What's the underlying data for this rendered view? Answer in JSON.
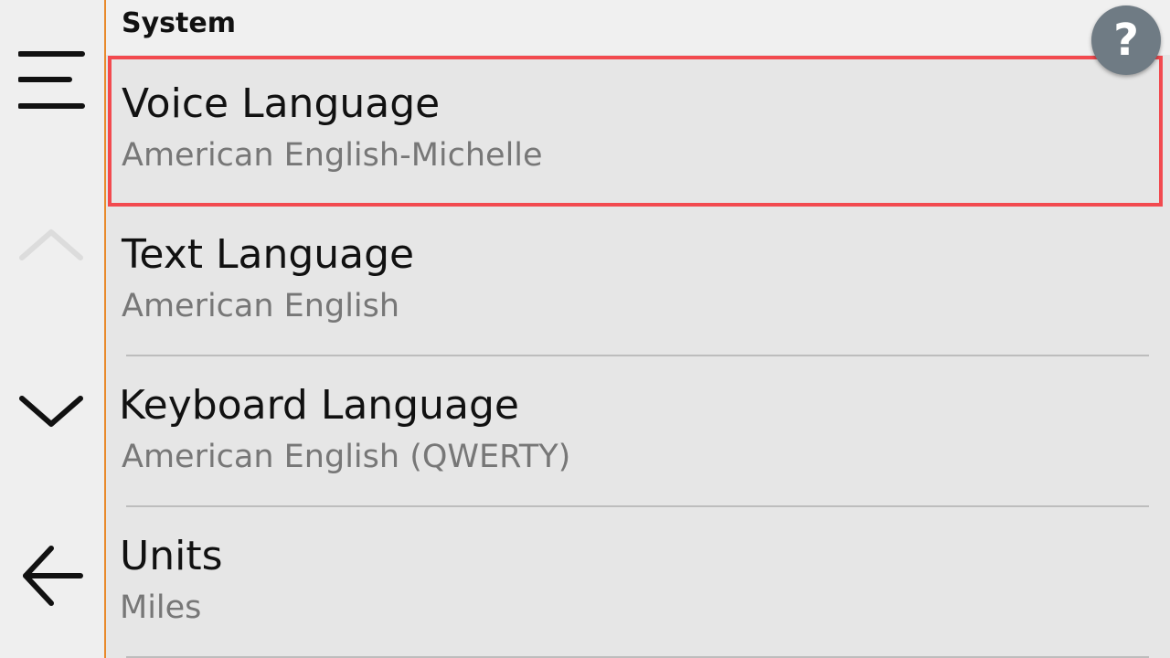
{
  "header": {
    "title": "System",
    "help_label": "?"
  },
  "sidebar": {
    "items": [
      {
        "icon": "menu-icon"
      },
      {
        "icon": "chevron-up-icon",
        "disabled": true
      },
      {
        "icon": "chevron-down-icon"
      },
      {
        "icon": "back-arrow-icon"
      }
    ]
  },
  "settings": {
    "items": [
      {
        "title": "Voice Language",
        "value": "American English-Michelle",
        "highlighted": true
      },
      {
        "title": "Text Language",
        "value": "American English"
      },
      {
        "title": "Keyboard Language",
        "value": "American English (QWERTY)"
      },
      {
        "title": "Units",
        "value": "Miles"
      }
    ]
  },
  "colors": {
    "highlight": "#f24a4f",
    "sidebar_border": "#e8892b",
    "help_button": "#6f7b84"
  }
}
